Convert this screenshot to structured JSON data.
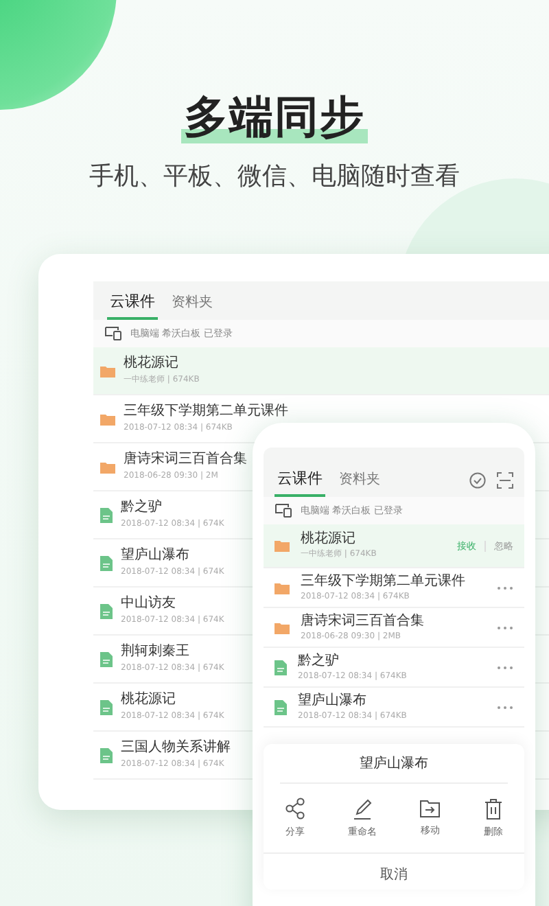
{
  "headline": "多端同步",
  "subtitle": "手机、平板、微信、电脑随时查看",
  "tablet": {
    "tabs": [
      {
        "label": "云课件",
        "selected": true
      },
      {
        "label": "资料夹",
        "selected": false
      }
    ],
    "device_status": "电脑端 希沃白板 已登录",
    "files": [
      {
        "kind": "folder",
        "name": "桃花源记",
        "meta": "一中练老师 | 674KB",
        "selected": true
      },
      {
        "kind": "folder",
        "name": "三年级下学期第二单元课件",
        "meta": "2018-07-12 08:34 | 674KB",
        "selected": false
      },
      {
        "kind": "folder",
        "name": "唐诗宋词三百首合集",
        "meta": "2018-06-28 09:30 | 2M",
        "selected": false
      },
      {
        "kind": "document",
        "name": "黔之驴",
        "meta": "2018-07-12 08:34 | 674K",
        "selected": false
      },
      {
        "kind": "document",
        "name": "望庐山瀑布",
        "meta": "2018-07-12 08:34 | 674K",
        "selected": false
      },
      {
        "kind": "document",
        "name": "中山访友",
        "meta": "2018-07-12 08:34 | 674K",
        "selected": false
      },
      {
        "kind": "document",
        "name": "荆轲刺秦王",
        "meta": "2018-07-12 08:34 | 674K",
        "selected": false
      },
      {
        "kind": "document",
        "name": "桃花源记",
        "meta": "2018-07-12 08:34 | 674K",
        "selected": false
      },
      {
        "kind": "document",
        "name": "三国人物关系讲解",
        "meta": "2018-07-12 08:34 | 674K",
        "selected": false
      }
    ]
  },
  "phone": {
    "tabs": [
      {
        "label": "云课件",
        "selected": true
      },
      {
        "label": "资料夹",
        "selected": false
      }
    ],
    "device_status": "电脑端 希沃白板 已登录",
    "files": [
      {
        "kind": "folder",
        "name": "桃花源记",
        "meta": "一中练老师 | 674KB",
        "selected": true,
        "actions": [
          "接收",
          "忽略"
        ]
      },
      {
        "kind": "folder",
        "name": "三年级下学期第二单元课件",
        "meta": "2018-07-12 08:34 | 674KB",
        "selected": false
      },
      {
        "kind": "folder",
        "name": "唐诗宋词三百首合集",
        "meta": "2018-06-28 09:30 | 2MB",
        "selected": false
      },
      {
        "kind": "document",
        "name": "黔之驴",
        "meta": "2018-07-12 08:34 | 674KB",
        "selected": false
      },
      {
        "kind": "document",
        "name": "望庐山瀑布",
        "meta": "2018-07-12 08:34 | 674KB",
        "selected": false
      }
    ],
    "sheet": {
      "title": "望庐山瀑布",
      "actions": [
        {
          "kind": "share",
          "label": "分享"
        },
        {
          "kind": "rename",
          "label": "重命名"
        },
        {
          "kind": "move",
          "label": "移动"
        },
        {
          "kind": "delete",
          "label": "删除"
        }
      ],
      "cancel": "取消"
    }
  }
}
